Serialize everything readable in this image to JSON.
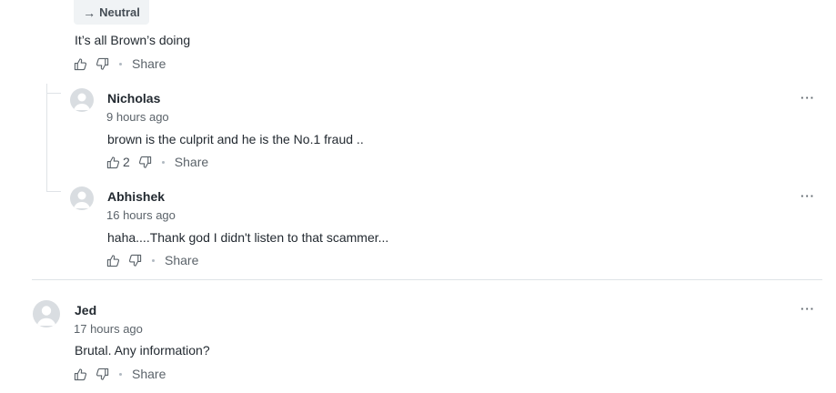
{
  "top_comment": {
    "sentiment": {
      "arrow": "→",
      "label": "Neutral"
    },
    "text": "It’s all Brown’s doing",
    "share_label": "Share"
  },
  "replies": [
    {
      "name": "Nicholas",
      "time": "9 hours ago",
      "text": "brown is the culprit and he is the No.1 fraud ..",
      "likes": "2",
      "share_label": "Share",
      "more_label": "···"
    },
    {
      "name": "Abhishek",
      "time": "16 hours ago",
      "text": "haha....Thank god I didn't listen to that scammer...",
      "likes": "",
      "share_label": "Share",
      "more_label": "···"
    }
  ],
  "next_comment": {
    "name": "Jed",
    "time": "17 hours ago",
    "text": "Brutal.  Any information?",
    "share_label": "Share",
    "more_label": "···"
  },
  "icons": {
    "like": "thumbs-up-icon",
    "dislike": "thumbs-down-icon",
    "avatar": "user-avatar-icon",
    "more": "more-options-icon"
  },
  "colors": {
    "text": "#232a31",
    "muted": "#5b636a",
    "avatar_bg": "#d9dde1",
    "badge_bg": "#f0f3f5"
  }
}
